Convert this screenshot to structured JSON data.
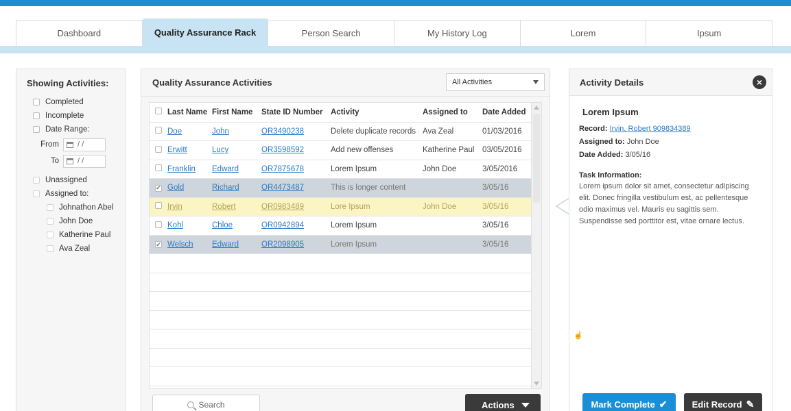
{
  "tabs": [
    "Dashboard",
    "Quality Assurance Rack",
    "Person Search",
    "My History Log",
    "Lorem",
    "Ipsum"
  ],
  "filters": {
    "title": "Showing Activities:",
    "completed": "Completed",
    "incomplete": "Incomplete",
    "date_range": "Date Range:",
    "from": "From",
    "to": "To",
    "date_placeholder": "/ /",
    "unassigned": "Unassigned",
    "assigned_to": "Assigned to:",
    "people": [
      "Johnathon Abel",
      "John Doe",
      "Katherine Paul",
      "Ava Zeal"
    ]
  },
  "activities": {
    "title": "Quality Assurance Activities",
    "filter_select": "All Activities",
    "columns": [
      "Last Name",
      "First Name",
      "State ID Number",
      "Activity",
      "Assigned to",
      "Date Added"
    ],
    "rows": [
      {
        "checked": "",
        "last": "Doe",
        "first": "John",
        "id": "OR3490238",
        "activity": "Delete duplicate records",
        "assigned": "Ava Zeal",
        "date": "01/03/2016",
        "state": ""
      },
      {
        "checked": "",
        "last": "Erwitt",
        "first": "Lucy",
        "id": "OR3598592",
        "activity": "Add new offenses",
        "assigned": "Katherine Paul",
        "date": "03/05/2016",
        "state": ""
      },
      {
        "checked": "",
        "last": "Franklin",
        "first": "Edward",
        "id": "OR7875678",
        "activity": "Lorem Ipsum",
        "assigned": "John Doe",
        "date": "3/05/2016",
        "state": ""
      },
      {
        "checked": "✔",
        "last": "Gold",
        "first": "Richard",
        "id": "OR4473487",
        "activity": "This is longer content",
        "assigned": "",
        "date": "3/05/16",
        "state": "sel"
      },
      {
        "checked": "",
        "last": "Irvin",
        "first": "Robert",
        "id": "OR0983489",
        "activity": "Lore Ipsum",
        "assigned": "John Doe",
        "date": "3/05/16",
        "state": "hl"
      },
      {
        "checked": "",
        "last": "Kohl",
        "first": "Chloe",
        "id": "OR0942894",
        "activity": "Lorem Ipsum",
        "assigned": "",
        "date": "3/05/16",
        "state": ""
      },
      {
        "checked": "✔",
        "last": "Welsch",
        "first": "Edward",
        "id": "OR2098905",
        "activity": "Lorem Ipsum",
        "assigned": "",
        "date": "3/05/16",
        "state": "sel"
      }
    ],
    "search_placeholder": "Search",
    "actions_label": "Actions"
  },
  "details": {
    "title": "Activity Details",
    "heading": "Lorem Ipsum",
    "record_label": "Record:",
    "record_value": "Irvin, Robert 909834389",
    "assigned_label": "Assigned to:",
    "assigned_value": "John Doe",
    "date_label": "Date Added:",
    "date_value": "3/05/16",
    "task_label": "Task Information:",
    "task_text": "Lorem ipsum dolor sit amet, consectetur adipiscing elit. Donec fringilla vestibulum est, ac pellentesque odio maximus vel. Mauris eu sagittis sem. Suspendisse sed porttitor est, vitae ornare lectus.",
    "mark_complete": "Mark Complete",
    "edit_record": "Edit Record"
  },
  "colors": {
    "accent": "#1a8fd6",
    "tab_active": "#c8e3f3",
    "dark_button": "#3a3a3a",
    "row_selected": "#cfd5dc",
    "row_highlight": "#fbf5c3"
  }
}
